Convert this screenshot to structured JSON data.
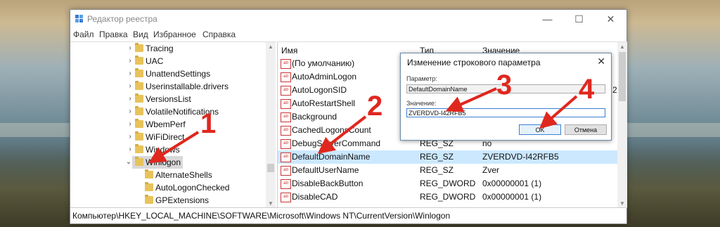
{
  "window": {
    "title": "Редактор реестра",
    "controls": {
      "minimize": "—",
      "maximize": "☐",
      "close": "✕"
    }
  },
  "menu": [
    "Файл",
    "Правка",
    "Вид",
    "Избранное",
    "Справка"
  ],
  "tree": {
    "items": [
      {
        "label": "Tracing",
        "expanded": false
      },
      {
        "label": "UAC",
        "expanded": false
      },
      {
        "label": "UnattendSettings",
        "expanded": false
      },
      {
        "label": "Userinstallable.drivers",
        "expanded": false
      },
      {
        "label": "VersionsList",
        "expanded": false
      },
      {
        "label": "VolatileNotifications",
        "expanded": false
      },
      {
        "label": "WbemPerf",
        "expanded": false
      },
      {
        "label": "WiFiDirect",
        "expanded": false
      },
      {
        "label": "Windows",
        "expanded": false
      },
      {
        "label": "Winlogon",
        "expanded": true,
        "selected": true
      },
      {
        "label": "AlternateShells",
        "child": true
      },
      {
        "label": "AutoLogonChecked",
        "child": true
      },
      {
        "label": "GPExtensions",
        "child": true
      }
    ]
  },
  "list": {
    "headers": {
      "name": "Имя",
      "type": "Тип",
      "value": "Значение"
    },
    "rows": [
      {
        "name": "(По умолчанию)",
        "type": "",
        "value": ""
      },
      {
        "name": "AutoAdminLogon",
        "type": "",
        "value": ""
      },
      {
        "name": "AutoLogonSID",
        "type": "",
        "value": "2"
      },
      {
        "name": "AutoRestartShell",
        "type": "",
        "value": ""
      },
      {
        "name": "Background",
        "type": "",
        "value": ""
      },
      {
        "name": "CachedLogonsCount",
        "type": "",
        "value": ""
      },
      {
        "name": "DebugServerCommand",
        "type": "REG_SZ",
        "value": "no"
      },
      {
        "name": "DefaultDomainName",
        "type": "REG_SZ",
        "value": "ZVERDVD-I42RFB5",
        "selected": true
      },
      {
        "name": "DefaultUserName",
        "type": "REG_SZ",
        "value": "Zver"
      },
      {
        "name": "DisableBackButton",
        "type": "REG_DWORD",
        "value": "0x00000001 (1)"
      },
      {
        "name": "DisableCAD",
        "type": "REG_DWORD",
        "value": "0x00000001 (1)"
      }
    ]
  },
  "status": "Компьютер\\HKEY_LOCAL_MACHINE\\SOFTWARE\\Microsoft\\Windows NT\\CurrentVersion\\Winlogon",
  "dialog": {
    "title": "Изменение строкового параметра",
    "close": "✕",
    "param_label": "Параметр:",
    "param_value": "DefaultDomainName",
    "value_label": "Значение:",
    "value_value": "ZVERDVD-I42RFB5",
    "ok": "OK",
    "cancel": "Отмена"
  },
  "annotations": [
    "1",
    "2",
    "3",
    "4"
  ],
  "colors": {
    "annotation": "#e0271e",
    "selection": "#cce8ff",
    "folder": "#e8c35b"
  }
}
